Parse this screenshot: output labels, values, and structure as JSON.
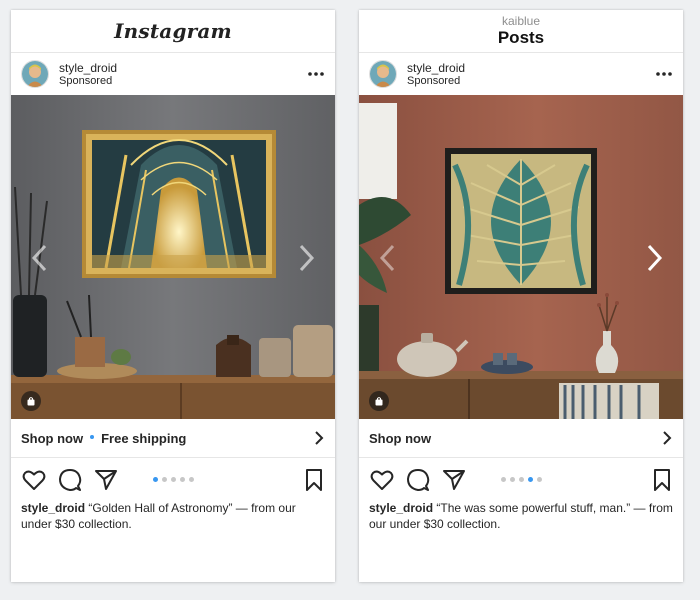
{
  "left_post": {
    "app_title": "Instagram",
    "username": "style_droid",
    "sponsored_label": "Sponsored",
    "artwork": "Golden Hall of Astronomy",
    "shop_label": "Shop now",
    "shop_extra": "Free shipping",
    "caption_user": "style_droid",
    "caption_text": "“Golden Hall of Astronomy” — from our under $30 collection.",
    "carousel": {
      "count": 5,
      "active_index": 0
    }
  },
  "right_post": {
    "profile_handle": "kaiblue",
    "page_title": "Posts",
    "username": "style_droid",
    "sponsored_label": "Sponsored",
    "shop_label": "Shop now",
    "caption_user": "style_droid",
    "caption_text": "“The was some powerful stuff, man.” — from our under $30 collection.",
    "carousel": {
      "count": 5,
      "active_index": 3
    }
  },
  "colors": {
    "accent_blue": "#3897f0",
    "text": "#262626",
    "muted": "#8e8e8e"
  },
  "icons": [
    "more-icon",
    "chevron-left-icon",
    "chevron-right-icon",
    "shopping-bag-icon",
    "heart-icon",
    "comment-icon",
    "share-icon",
    "bookmark-icon"
  ]
}
